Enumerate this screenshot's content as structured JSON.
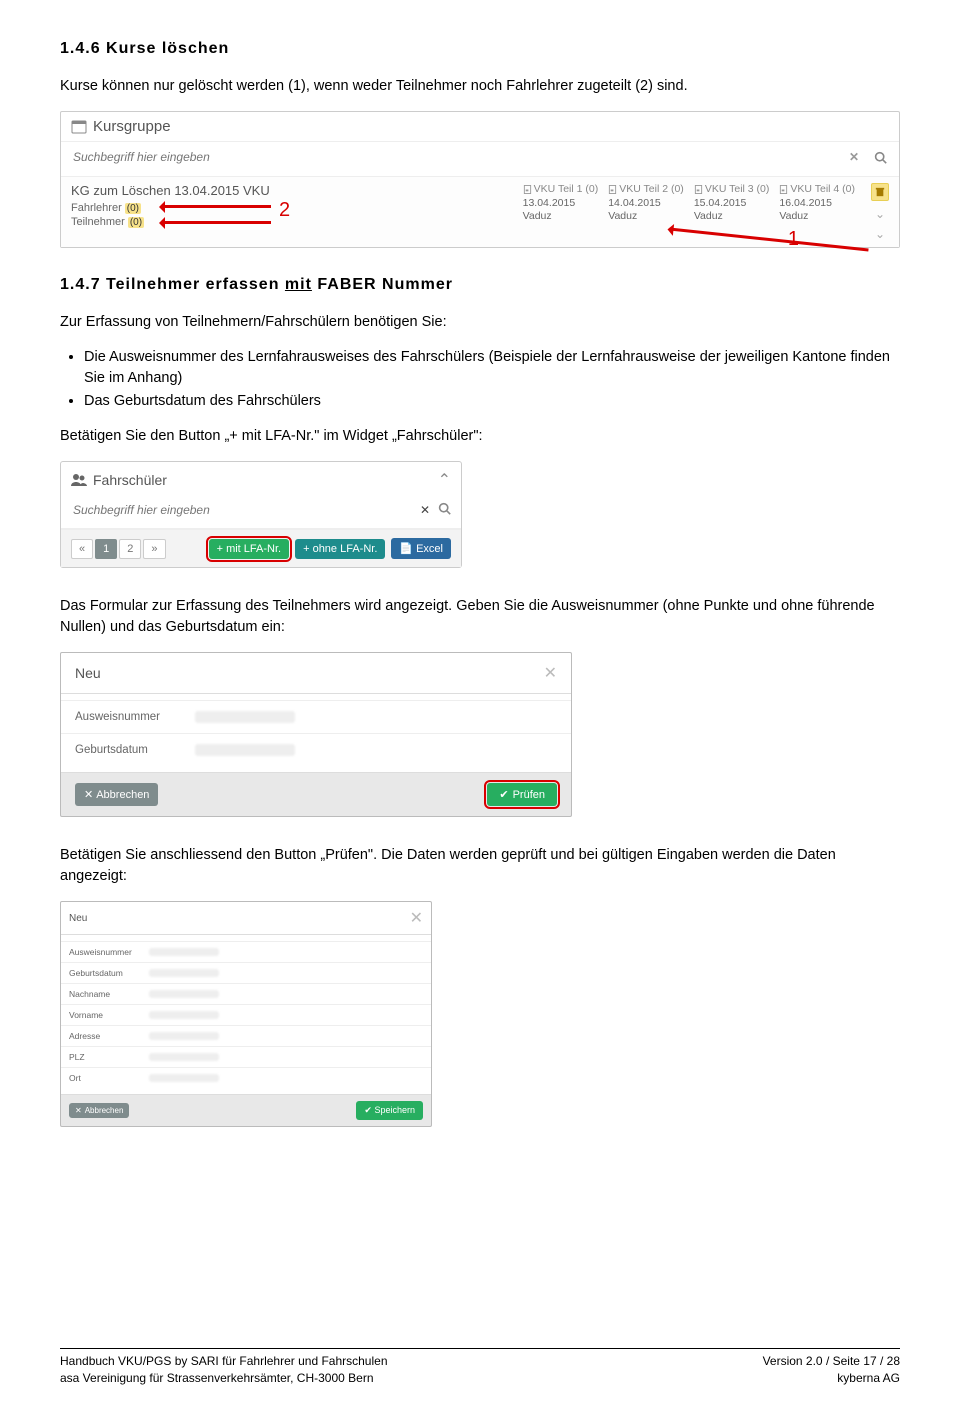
{
  "section1": {
    "heading": "1.4.6 Kurse löschen",
    "para": "Kurse können nur gelöscht werden (1), wenn weder Teilnehmer noch Fahrlehrer zugeteilt (2) sind."
  },
  "kursgruppe": {
    "title": "Kursgruppe",
    "search_placeholder": "Suchbegriff hier eingeben",
    "row_title": "KG zum Löschen 13.04.2015 VKU",
    "fahrlehrer_label": "Fahrlehrer",
    "fahrlehrer_count": "(0)",
    "teilnehmer_label": "Teilnehmer",
    "teilnehmer_count": "(0)",
    "parts": [
      {
        "hdr": "VKU Teil 1 (0)",
        "date": "13.04.2015",
        "city": "Vaduz"
      },
      {
        "hdr": "VKU Teil 2 (0)",
        "date": "14.04.2015",
        "city": "Vaduz"
      },
      {
        "hdr": "VKU Teil 3 (0)",
        "date": "15.04.2015",
        "city": "Vaduz"
      },
      {
        "hdr": "VKU Teil 4 (0)",
        "date": "16.04.2015",
        "city": "Vaduz"
      }
    ],
    "annot1": "1",
    "annot2": "2"
  },
  "section2": {
    "heading_pre": "1.4.7 Teilnehmer erfassen ",
    "heading_u": "mit",
    "heading_post": " FABER Nummer",
    "intro": "Zur Erfassung von Teilnehmern/Fahrschülern benötigen Sie:",
    "bullets": [
      "Die Ausweisnummer des Lernfahrausweises des Fahrschülers (Beispiele der Lernfahrausweise der jeweiligen Kantone finden Sie im Anhang)",
      "Das Geburtsdatum des Fahrschülers"
    ],
    "action": "Betätigen Sie den Button „+ mit LFA-Nr.\" im Widget „Fahrschüler\":"
  },
  "fahrschueler": {
    "title": "Fahrschüler",
    "search_placeholder": "Suchbegriff hier eingeben",
    "pages": [
      "«",
      "1",
      "2",
      "»"
    ],
    "btn_mit": "+ mit LFA-Nr.",
    "btn_ohne": "+ ohne LFA-Nr.",
    "btn_excel": "Excel"
  },
  "section3": {
    "para": "Das Formular zur Erfassung des Teilnehmers wird angezeigt. Geben Sie die Ausweisnummer (ohne Punkte und ohne führende Nullen) und das Geburtsdatum ein:"
  },
  "modal1": {
    "title": "Neu",
    "row1": "Ausweisnummer",
    "row2": "Geburtsdatum",
    "cancel": "Abbrechen",
    "pruefen": "Prüfen"
  },
  "section4": {
    "para": "Betätigen Sie anschliessend den Button „Prüfen\". Die Daten werden geprüft und bei gültigen Eingaben werden die Daten angezeigt:"
  },
  "modal2": {
    "title": "Neu",
    "rows": [
      "Ausweisnummer",
      "Geburtsdatum",
      "Nachname",
      "Vorname",
      "Adresse",
      "PLZ",
      "Ort"
    ],
    "cancel": "Abbrechen",
    "save": "Speichern"
  },
  "footer": {
    "l1": "Handbuch VKU/PGS by SARI für Fahrlehrer und Fahrschulen",
    "l2": "asa Vereinigung für Strassenverkehrsämter, CH-3000 Bern",
    "r1": "Version 2.0 / Seite 17 / 28",
    "r2": "kyberna AG"
  }
}
